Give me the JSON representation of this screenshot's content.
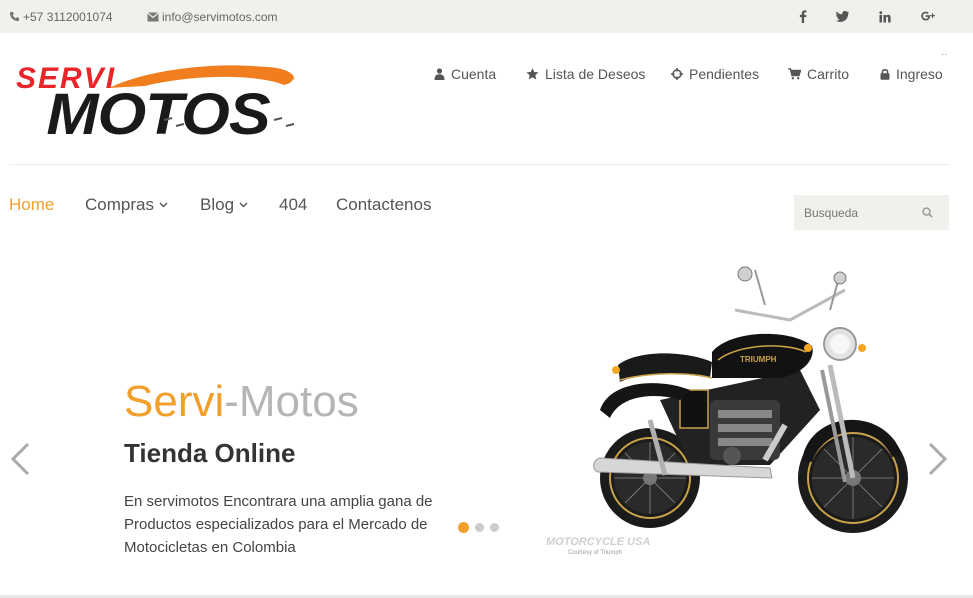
{
  "topbar": {
    "phone": "+57 3112001074",
    "email": "info@servimotos.com",
    "social": [
      "facebook-icon",
      "twitter-icon",
      "linkedin-icon",
      "google-plus-icon"
    ]
  },
  "logo": {
    "line1": "SERVI",
    "line2": "MOTOS"
  },
  "account_menu": [
    {
      "label": "Cuenta",
      "icon": "user-icon"
    },
    {
      "label": "Lista de Deseos",
      "icon": "star-icon"
    },
    {
      "label": "Pendientes",
      "icon": "crosshair-icon"
    },
    {
      "label": "Carrito",
      "icon": "cart-icon"
    },
    {
      "label": "Ingreso",
      "icon": "lock-icon"
    }
  ],
  "nav": [
    {
      "label": "Home",
      "active": true
    },
    {
      "label": "Compras",
      "dropdown": true
    },
    {
      "label": "Blog",
      "dropdown": true
    },
    {
      "label": "404"
    },
    {
      "label": "Contactenos"
    }
  ],
  "search": {
    "placeholder": "Busqueda"
  },
  "slider": {
    "title_part1": "Servi",
    "title_part2": "-Motos",
    "subtitle": "Tienda Online",
    "text": "En servimotos Encontrara una amplia gana de Productos especializados para el Mercado de Motocicletas en Colombia",
    "image_watermark": "MOTORCYCLE USA",
    "image_credit": "Courtesy of Triumph",
    "tank_badge": "TRIUMPH",
    "active_slide": 1,
    "slide_count": 3
  },
  "colors": {
    "accent": "#f1a02d",
    "logo_red": "#e8262a",
    "logo_orange": "#f07d1e",
    "logo_black": "#1a1a1a"
  }
}
